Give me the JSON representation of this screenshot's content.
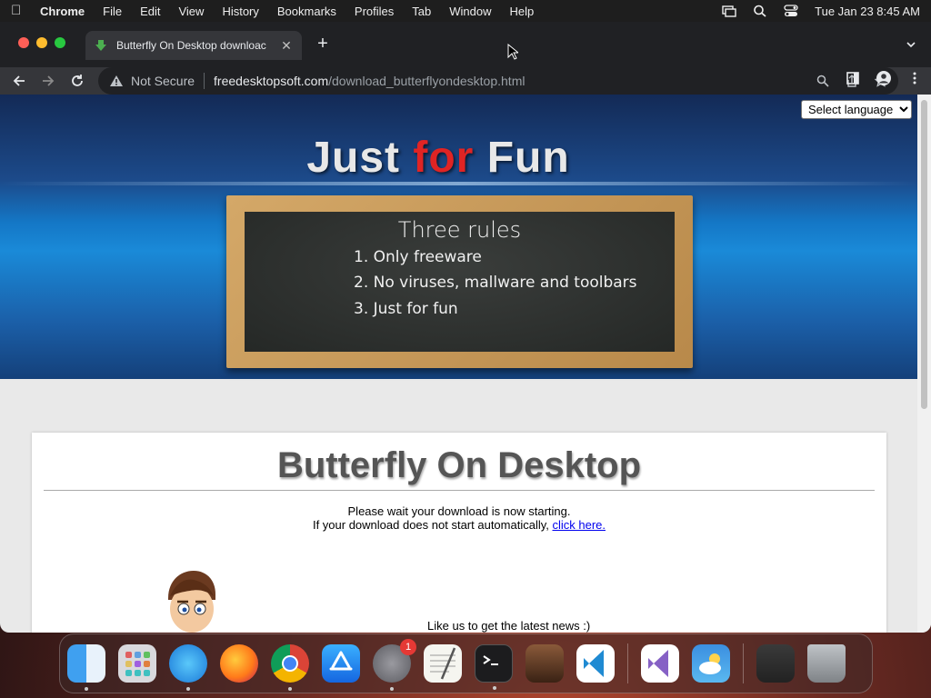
{
  "menubar": {
    "app": "Chrome",
    "items": [
      "File",
      "Edit",
      "View",
      "History",
      "Bookmarks",
      "Profiles",
      "Tab",
      "Window",
      "Help"
    ],
    "datetime": "Tue Jan 23  8:45 AM"
  },
  "browser": {
    "tab_title": "Butterfly On Desktop downloac",
    "security": "Not Secure",
    "url_domain": "freedesktopsoft.com",
    "url_path": "/download_butterflyondesktop.html"
  },
  "page": {
    "language_select": "Select language",
    "hero_title_1": "Just ",
    "hero_title_accent": "for",
    "hero_title_2": " Fun",
    "chalkboard": {
      "heading": "Three rules",
      "rules": [
        "1. Only freeware",
        "2. No viruses, mallware and toolbars",
        "3. Just for fun"
      ]
    },
    "title": "Butterfly On Desktop",
    "wait_msg": "Please wait your download is now starting.",
    "fallback_msg": "If your download does not start automatically, ",
    "fallback_link": "click here.",
    "like_msg": "Like us to get the latest news :)"
  },
  "dock": {
    "apps": [
      "Finder",
      "Launchpad",
      "Safari",
      "Firefox",
      "Chrome",
      "App Store",
      "System Settings",
      "TextEdit",
      "Terminal",
      "GarageBand",
      "VS Code",
      "Visual Studio",
      "Weather",
      "Downloads",
      "Trash"
    ],
    "settings_badge": "1"
  }
}
